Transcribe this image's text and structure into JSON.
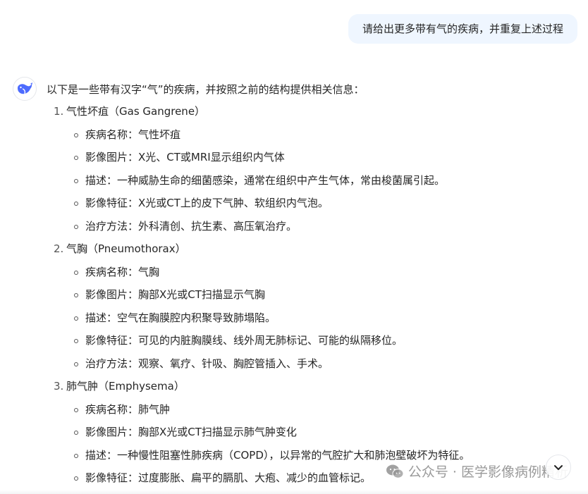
{
  "user": {
    "message": "请给出更多带有气的疾病，并重复上述过程"
  },
  "assistant": {
    "intro": "以下是一些带有汉字“气”的疾病，并按照之前的结构提供相关信息：",
    "diseases": [
      {
        "num": "1.",
        "title": "气性坏疽（Gas Gangrene）",
        "details": [
          "疾病名称：气性坏疽",
          "影像图片：X光、CT或MRI显示组织内气体",
          "描述：一种威胁生命的细菌感染，通常在组织中产生气体，常由梭菌属引起。",
          "影像特征：X光或CT上的皮下气肿、软组织内气泡。",
          "治疗方法：外科清创、抗生素、高压氧治疗。"
        ]
      },
      {
        "num": "2.",
        "title": "气胸（Pneumothorax）",
        "details": [
          "疾病名称：气胸",
          "影像图片：胸部X光或CT扫描显示气胸",
          "描述：空气在胸膜腔内积聚导致肺塌陷。",
          "影像特征：可见的内脏胸膜线、线外周无肺标记、可能的纵隔移位。",
          "治疗方法：观察、氧疗、针吸、胸腔管插入、手术。"
        ]
      },
      {
        "num": "3.",
        "title": "肺气肿（Emphysema）",
        "details": [
          "疾病名称：肺气肿",
          "影像图片：胸部X光或CT扫描显示肺气肿变化",
          "描述：一种慢性阻塞性肺疾病（COPD），以异常的气腔扩大和肺泡壁破坏为特征。",
          "影像特征：过度膨胀、扁平的膈肌、大疱、减少的血管标记。"
        ]
      }
    ]
  },
  "watermark": {
    "text": "公众号 · 医学影像病例精析"
  },
  "icons": {
    "avatar": "whale-logo-icon",
    "scroll": "chevron-down-icon",
    "watermark": "wechat-icon"
  },
  "colors": {
    "user_bubble": "#eff6ff",
    "brand": "#4d6bfe",
    "text": "#262626"
  }
}
